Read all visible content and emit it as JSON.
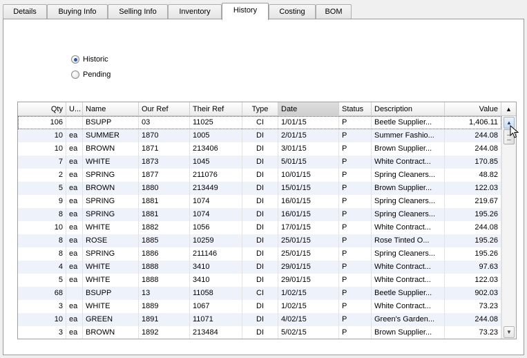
{
  "tabs": [
    {
      "label": "Details"
    },
    {
      "label": "Buying Info"
    },
    {
      "label": "Selling Info"
    },
    {
      "label": "Inventory"
    },
    {
      "label": "History"
    },
    {
      "label": "Costing"
    },
    {
      "label": "BOM"
    }
  ],
  "active_tab": "History",
  "options": {
    "historic_label": "Historic",
    "pending_label": "Pending",
    "selected": "Historic"
  },
  "grid": {
    "columns": {
      "qty": "Qty",
      "u": "U...",
      "name": "Name",
      "our_ref": "Our Ref",
      "their_ref": "Their Ref",
      "type": "Type",
      "date": "Date",
      "status": "Status",
      "description": "Description",
      "value": "Value"
    },
    "sorted_column": "Date",
    "corner_icon": "sort-arrows-icon",
    "rows": [
      {
        "qty": "106",
        "u": "",
        "name": "BSUPP",
        "our_ref": "03",
        "their_ref": "11025",
        "type": "CI",
        "date": "1/01/15",
        "status": "P",
        "description": "Beetle Supplier...",
        "value": "1,406.11"
      },
      {
        "qty": "10",
        "u": "ea",
        "name": "SUMMER",
        "our_ref": "1870",
        "their_ref": "1005",
        "type": "DI",
        "date": "2/01/15",
        "status": "P",
        "description": "Summer Fashio...",
        "value": "244.08"
      },
      {
        "qty": "10",
        "u": "ea",
        "name": "BROWN",
        "our_ref": "1871",
        "their_ref": "213406",
        "type": "DI",
        "date": "3/01/15",
        "status": "P",
        "description": "Brown Supplier...",
        "value": "244.08"
      },
      {
        "qty": "7",
        "u": "ea",
        "name": "WHITE",
        "our_ref": "1873",
        "their_ref": "1045",
        "type": "DI",
        "date": "5/01/15",
        "status": "P",
        "description": "White Contract...",
        "value": "170.85"
      },
      {
        "qty": "2",
        "u": "ea",
        "name": "SPRING",
        "our_ref": "1877",
        "their_ref": "211076",
        "type": "DI",
        "date": "10/01/15",
        "status": "P",
        "description": "Spring Cleaners...",
        "value": "48.82"
      },
      {
        "qty": "5",
        "u": "ea",
        "name": "BROWN",
        "our_ref": "1880",
        "their_ref": "213449",
        "type": "DI",
        "date": "15/01/15",
        "status": "P",
        "description": "Brown Supplier...",
        "value": "122.03"
      },
      {
        "qty": "9",
        "u": "ea",
        "name": "SPRING",
        "our_ref": "1881",
        "their_ref": "1074",
        "type": "DI",
        "date": "16/01/15",
        "status": "P",
        "description": "Spring Cleaners...",
        "value": "219.67"
      },
      {
        "qty": "8",
        "u": "ea",
        "name": "SPRING",
        "our_ref": "1881",
        "their_ref": "1074",
        "type": "DI",
        "date": "16/01/15",
        "status": "P",
        "description": "Spring Cleaners...",
        "value": "195.26"
      },
      {
        "qty": "10",
        "u": "ea",
        "name": "WHITE",
        "our_ref": "1882",
        "their_ref": "1056",
        "type": "DI",
        "date": "17/01/15",
        "status": "P",
        "description": "White Contract...",
        "value": "244.08"
      },
      {
        "qty": "8",
        "u": "ea",
        "name": "ROSE",
        "our_ref": "1885",
        "their_ref": "10259",
        "type": "DI",
        "date": "25/01/15",
        "status": "P",
        "description": "Rose Tinted O...",
        "value": "195.26"
      },
      {
        "qty": "8",
        "u": "ea",
        "name": "SPRING",
        "our_ref": "1886",
        "their_ref": "211146",
        "type": "DI",
        "date": "25/01/15",
        "status": "P",
        "description": "Spring Cleaners...",
        "value": "195.26"
      },
      {
        "qty": "4",
        "u": "ea",
        "name": "WHITE",
        "our_ref": "1888",
        "their_ref": "3410",
        "type": "DI",
        "date": "29/01/15",
        "status": "P",
        "description": "White Contract...",
        "value": "97.63"
      },
      {
        "qty": "5",
        "u": "ea",
        "name": "WHITE",
        "our_ref": "1888",
        "their_ref": "3410",
        "type": "DI",
        "date": "29/01/15",
        "status": "P",
        "description": "White Contract...",
        "value": "122.03"
      },
      {
        "qty": "68",
        "u": "",
        "name": "BSUPP",
        "our_ref": "13",
        "their_ref": "11058",
        "type": "CI",
        "date": "1/02/15",
        "status": "P",
        "description": "Beetle Supplier...",
        "value": "902.03"
      },
      {
        "qty": "3",
        "u": "ea",
        "name": "WHITE",
        "our_ref": "1889",
        "their_ref": "1067",
        "type": "DI",
        "date": "1/02/15",
        "status": "P",
        "description": "White Contract...",
        "value": "73.23"
      },
      {
        "qty": "10",
        "u": "ea",
        "name": "GREEN",
        "our_ref": "1891",
        "their_ref": "11071",
        "type": "DI",
        "date": "4/02/15",
        "status": "P",
        "description": "Green's Garden...",
        "value": "244.08"
      },
      {
        "qty": "3",
        "u": "ea",
        "name": "BROWN",
        "our_ref": "1892",
        "their_ref": "213484",
        "type": "DI",
        "date": "5/02/15",
        "status": "P",
        "description": "Brown Supplier...",
        "value": "73.23"
      }
    ]
  },
  "scrollbar": {
    "up_icon": "arrow-up-icon",
    "down_icon": "arrow-down-icon"
  },
  "colors": {
    "row_alt": "#eef3fb",
    "radio_dot": "#2a55b0"
  }
}
